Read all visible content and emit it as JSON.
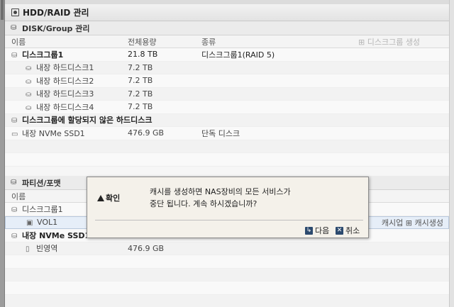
{
  "panel": {
    "title": "HDD/RAID 관리"
  },
  "disk_group": {
    "header": "DISK/Group 관리",
    "columns": [
      "이름",
      "전체용량",
      "종류"
    ],
    "create_button": "디스크그룹 생성",
    "rows": [
      {
        "name": "디스크그룹1",
        "capacity": "21.8 TB",
        "type": "디스크그룹1(RAID 5)",
        "bold": true
      },
      {
        "name": "내장 하드디스크1",
        "capacity": "7.2 TB",
        "type": ""
      },
      {
        "name": "내장 하드디스크2",
        "capacity": "7.2 TB",
        "type": ""
      },
      {
        "name": "내장 하드디스크3",
        "capacity": "7.2 TB",
        "type": ""
      },
      {
        "name": "내장 하드디스크4",
        "capacity": "7.2 TB",
        "type": ""
      },
      {
        "name": "디스크그룹에 할당되지 않은 하드디스크",
        "capacity": "",
        "type": "",
        "bold": true
      },
      {
        "name": "내장 NVMe SSD1",
        "capacity": "476.9 GB",
        "type": "단독 디스크"
      }
    ]
  },
  "partition": {
    "header": "파티션/포맷",
    "columns": [
      "이름"
    ],
    "rows": [
      {
        "name": "디스크그룹1",
        "capacity": ""
      },
      {
        "name": "VOL1",
        "capacity": "",
        "actions": [
          "캐시업",
          "캐시생성"
        ]
      },
      {
        "name": "내장 NVMe SSD1",
        "capacity": "",
        "bold": true
      },
      {
        "name": "빈영역",
        "capacity": "476.9 GB"
      }
    ]
  },
  "dialog": {
    "title": "확인",
    "message_line1": "캐시를 생성하면 NAS장비의 모든 서비스가",
    "message_line2": "중단 됩니다. 계속 하시겠습니까?",
    "next_label": "다음",
    "cancel_label": "취소"
  }
}
